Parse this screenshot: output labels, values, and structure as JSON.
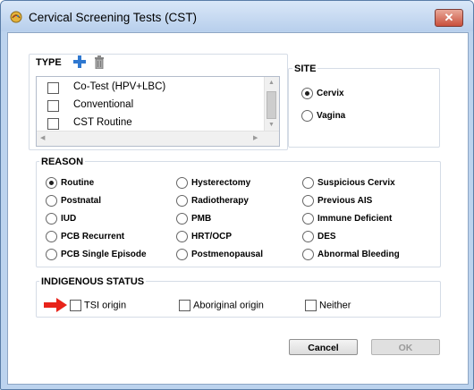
{
  "window": {
    "title": "Cervical Screening Tests (CST)",
    "close_label": "✕"
  },
  "type": {
    "label": "TYPE",
    "items": [
      {
        "label": "Co-Test (HPV+LBC)",
        "checked": false
      },
      {
        "label": "Conventional",
        "checked": false
      },
      {
        "label": "CST Routine",
        "checked": false
      }
    ]
  },
  "site": {
    "label": "SITE",
    "options": [
      {
        "label": "Cervix",
        "selected": true
      },
      {
        "label": "Vagina",
        "selected": false
      }
    ]
  },
  "reason": {
    "label": "REASON",
    "options": [
      {
        "label": "Routine",
        "selected": true
      },
      {
        "label": "Postnatal",
        "selected": false
      },
      {
        "label": "IUD",
        "selected": false
      },
      {
        "label": "PCB Recurrent",
        "selected": false
      },
      {
        "label": "PCB Single Episode",
        "selected": false
      },
      {
        "label": "Hysterectomy",
        "selected": false
      },
      {
        "label": "Radiotherapy",
        "selected": false
      },
      {
        "label": "PMB",
        "selected": false
      },
      {
        "label": "HRT/OCP",
        "selected": false
      },
      {
        "label": "Postmenopausal",
        "selected": false
      },
      {
        "label": "Suspicious Cervix",
        "selected": false
      },
      {
        "label": "Previous AIS",
        "selected": false
      },
      {
        "label": "Immune Deficient",
        "selected": false
      },
      {
        "label": "DES",
        "selected": false
      },
      {
        "label": "Abnormal Bleeding",
        "selected": false
      }
    ]
  },
  "indigenous_status": {
    "label": "INDIGENOUS STATUS",
    "options": [
      {
        "label": "TSI origin",
        "checked": false
      },
      {
        "label": "Aboriginal origin",
        "checked": false
      },
      {
        "label": "Neither",
        "checked": false
      }
    ]
  },
  "buttons": {
    "cancel": "Cancel",
    "ok": "OK"
  },
  "colors": {
    "accent_red": "#e8231a",
    "plus_blue": "#2f78d0"
  }
}
